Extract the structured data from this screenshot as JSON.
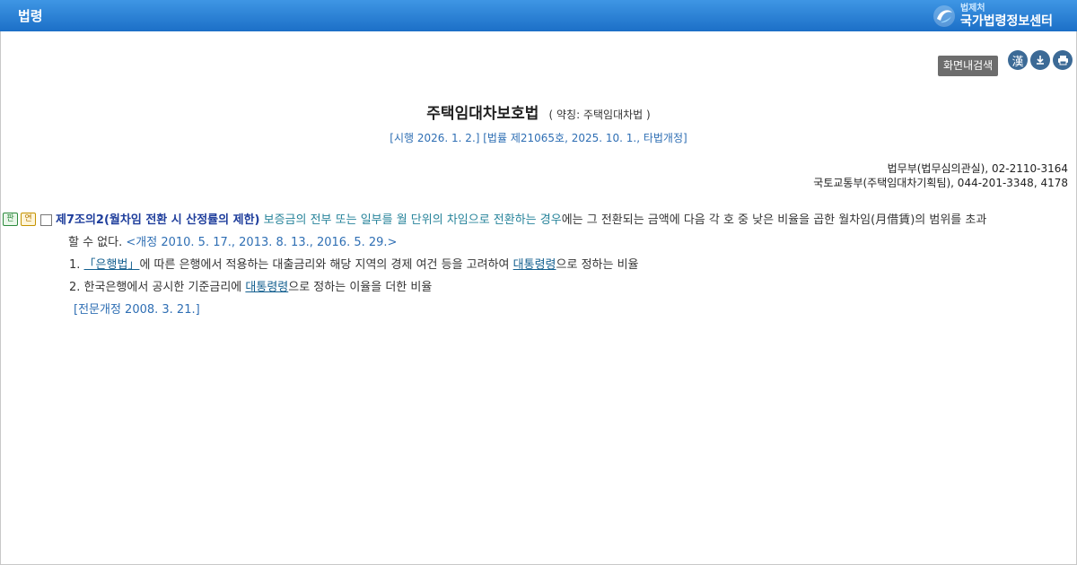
{
  "header": {
    "title": "법령",
    "logo": {
      "small": "법제처",
      "big": "국가법령정보센터"
    }
  },
  "toolbar": {
    "search_label": "화면내검색",
    "hanja_label": "漢",
    "icons": [
      "hanja-icon",
      "download-icon",
      "print-icon"
    ]
  },
  "law": {
    "title": "주택임대차보호법",
    "abbr": "( 약칭: 주택임대차법 )",
    "enforcement": "[시행 2026. 1. 2.] [법률 제21065호, 2025. 10. 1., 타법개정]",
    "contacts": [
      "법무부(법무심의관실), 02-2110-3164",
      "국토교통부(주택임대차기획팀), 044-201-3348, 4178"
    ]
  },
  "article": {
    "badge_pan": "판",
    "badge_yeon": "연",
    "title": "제7조의2(월차임 전환 시 산정률의 제한)",
    "lead": "보증금의 전부 또는 일부를 월 단위의 차임으로 전환하는 경우",
    "rest": "에는 그 전환되는 금액에 다음 각 호 중 낮은 비율을 곱한 월차임(月借賃)의 범위를 초과",
    "line2": "할 수 없다.",
    "amend": "<개정 2010. 5. 17., 2013. 8. 13., 2016. 5. 29.>",
    "item1": {
      "num": "1.",
      "link": "「은행법」",
      "text1": "에 따른 은행에서 적용하는 대출금리와 해당 지역의 경제 여건 등을 고려하여",
      "link2": "대통령령",
      "text2": "으로 정하는 비율"
    },
    "item2": {
      "num": "2.",
      "text1": "한국은행에서 공시한 기준금리에",
      "link": "대통령령",
      "text2": "으로 정하는 이율을 더한 비율"
    },
    "full_amend": "[전문개정 2008. 3. 21.]"
  },
  "colors": {
    "header": "#2b7fd6",
    "article_title": "#1f3e9c",
    "teal_text": "#26839a",
    "blue_text": "#2f6fb4"
  }
}
